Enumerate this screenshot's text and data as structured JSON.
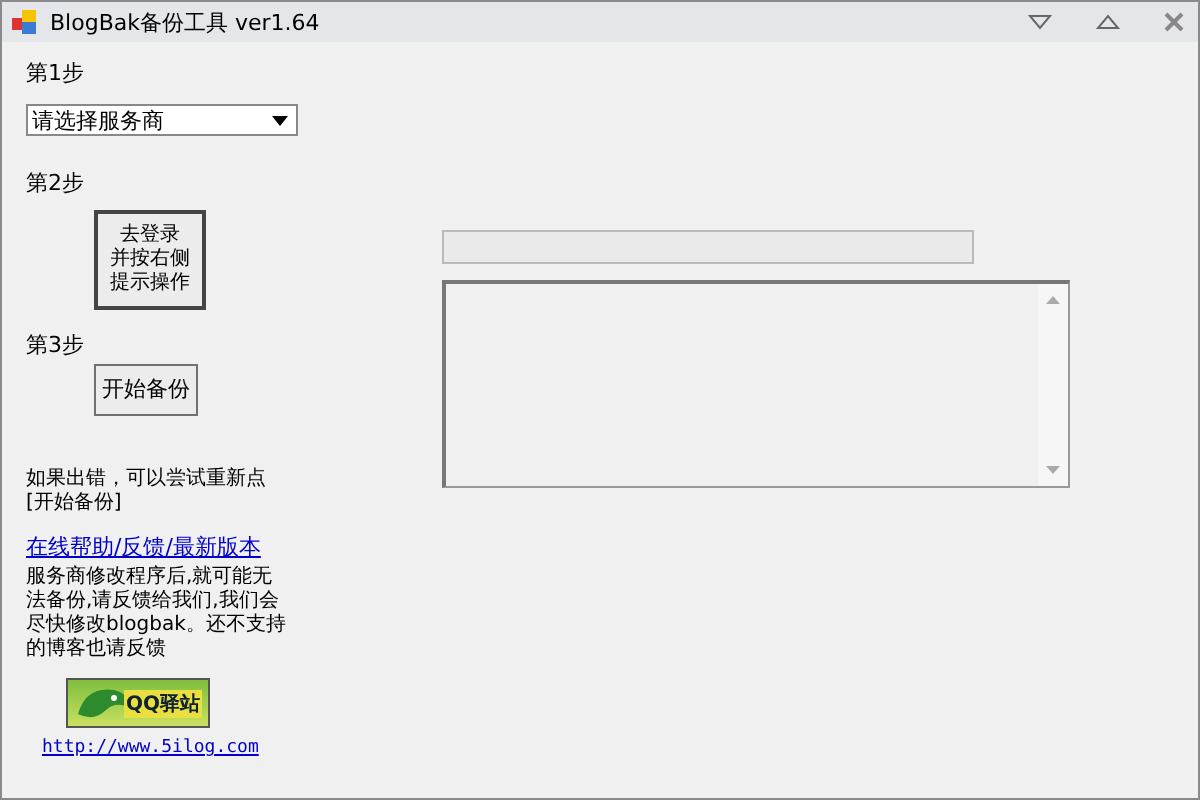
{
  "window": {
    "title": "BlogBak备份工具 ver1.64"
  },
  "step1": {
    "label": "第1步",
    "dropdown": {
      "value": "请选择服务商"
    }
  },
  "step2": {
    "label": "第2步",
    "button_lines": [
      "去登录",
      "并按右侧",
      "提示操作"
    ]
  },
  "step3": {
    "label": "第3步",
    "button": "开始备份"
  },
  "error_hint": "如果出错，可以尝试重新点[开始备份]",
  "help_link": "在线帮助/反馈/最新版本",
  "notice": "服务商修改程序后,就可能无法备份,请反馈给我们,我们会尽快修改blogbak。还不支持的博客也请反馈",
  "logo": {
    "text": "QQ驿站"
  },
  "site_link": "http://www.5ilog.com",
  "progress": {
    "level": 0
  }
}
